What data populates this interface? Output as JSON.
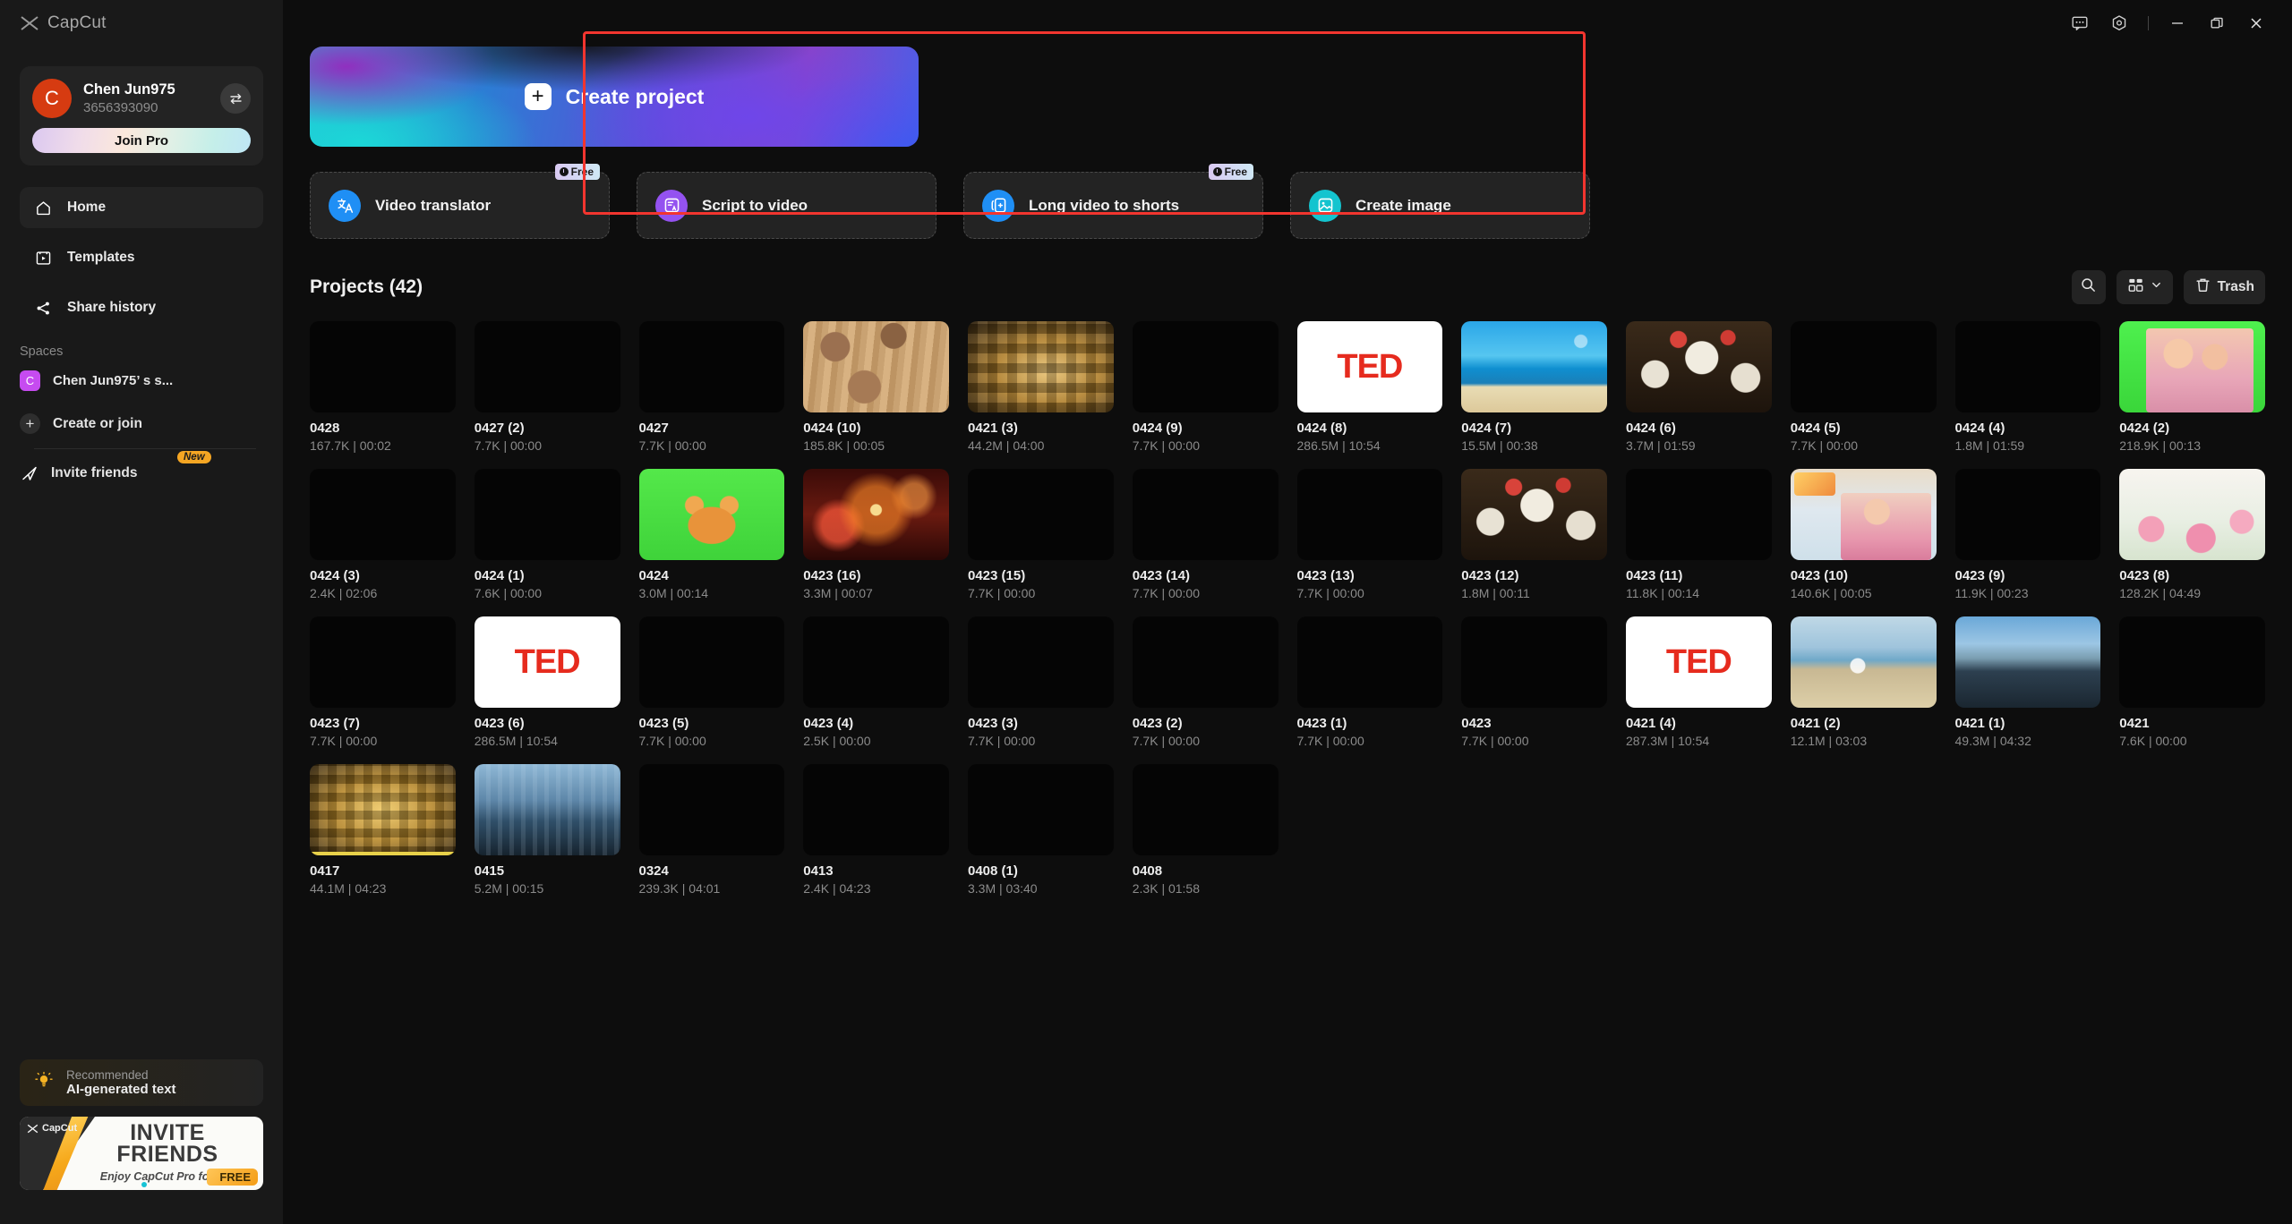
{
  "app": {
    "brand": "CapCut"
  },
  "titlebar": {
    "buttons": [
      {
        "name": "feedback-icon",
        "label": ""
      },
      {
        "name": "settings-icon",
        "label": ""
      },
      {
        "name": "minimize-icon",
        "label": ""
      },
      {
        "name": "maximize-icon",
        "label": ""
      },
      {
        "name": "close-icon",
        "label": ""
      }
    ]
  },
  "sidebar": {
    "user": {
      "name": "Chen Jun975",
      "id": "3656393090",
      "avatar_initial": "C",
      "avatar_color": "#d63b11",
      "switch_icon": "⇄",
      "pro_button": "Join Pro"
    },
    "nav": [
      {
        "label": "Home",
        "icon": "home-icon",
        "active": true
      },
      {
        "label": "Templates",
        "icon": "templates-icon",
        "active": false
      },
      {
        "label": "Share history",
        "icon": "share-icon",
        "active": false
      }
    ],
    "spaces_label": "Spaces",
    "spaces": [
      {
        "label": "Chen Jun975’ s s...",
        "badge": "C",
        "badge_color": "#c64bf0"
      }
    ],
    "create_or_join": "Create or join",
    "invite_friends": "Invite friends",
    "invite_badge": "New",
    "promo": {
      "recommended_label": "Recommended",
      "recommended_title": "AI-generated text",
      "card_brand": "CapCut",
      "card_title_line1": "INVITE",
      "card_title_line2": "FRIENDS",
      "card_subtitle": "Enjoy CapCut Pro for",
      "card_free": "FREE"
    }
  },
  "main": {
    "create_project": {
      "label": "Create project",
      "icon": "plus-icon"
    },
    "features": [
      {
        "label": "Video translator",
        "icon": "translate-icon",
        "icon_color": "#1f8ff5",
        "badge": "Free"
      },
      {
        "label": "Script to video",
        "icon": "script-icon",
        "icon_color": "#9452f0",
        "badge": ""
      },
      {
        "label": "Long video to shorts",
        "icon": "shorts-icon",
        "icon_color": "#1f8ff5",
        "badge": "Free"
      },
      {
        "label": "Create image",
        "icon": "image-icon",
        "icon_color": "#14c4cf",
        "badge": ""
      }
    ],
    "projects_title": "Projects",
    "projects_count": "(42)",
    "toolbar": {
      "search_icon": "search-icon",
      "view_icon": "grid-view-icon",
      "view_caret": "chevron-down-icon",
      "trash_label": "Trash",
      "trash_icon": "trash-icon"
    },
    "projects": [
      {
        "name": "0428",
        "meta": "167.7K | 00:02",
        "thumb": "t-black"
      },
      {
        "name": "0427 (2)",
        "meta": "7.7K | 00:00",
        "thumb": "t-black"
      },
      {
        "name": "0427",
        "meta": "7.7K | 00:00",
        "thumb": "t-black"
      },
      {
        "name": "0424 (10)",
        "meta": "185.8K | 00:05",
        "thumb": "t-wood"
      },
      {
        "name": "0421 (3)",
        "meta": "44.2M | 04:00",
        "thumb": "t-mosaic"
      },
      {
        "name": "0424 (9)",
        "meta": "7.7K | 00:00",
        "thumb": "t-black"
      },
      {
        "name": "0424 (8)",
        "meta": "286.5M | 10:54",
        "thumb": "t-ted"
      },
      {
        "name": "0424 (7)",
        "meta": "15.5M | 00:38",
        "thumb": "t-beach"
      },
      {
        "name": "0424 (6)",
        "meta": "3.7M | 01:59",
        "thumb": "t-globes"
      },
      {
        "name": "0424 (5)",
        "meta": "7.7K | 00:00",
        "thumb": "t-black"
      },
      {
        "name": "0424 (4)",
        "meta": "1.8M | 01:59",
        "thumb": "t-black"
      },
      {
        "name": "0424 (2)",
        "meta": "218.9K | 00:13",
        "thumb": "t-green"
      },
      {
        "name": "0424 (3)",
        "meta": "2.4K | 02:06",
        "thumb": "t-black"
      },
      {
        "name": "0424 (1)",
        "meta": "7.6K | 00:00",
        "thumb": "t-black"
      },
      {
        "name": "0424",
        "meta": "3.0M | 00:14",
        "thumb": "t-cat"
      },
      {
        "name": "0423 (16)",
        "meta": "3.3M | 00:07",
        "thumb": "t-fire"
      },
      {
        "name": "0423 (15)",
        "meta": "7.7K | 00:00",
        "thumb": "t-black"
      },
      {
        "name": "0423 (14)",
        "meta": "7.7K | 00:00",
        "thumb": "t-black"
      },
      {
        "name": "0423 (13)",
        "meta": "7.7K | 00:00",
        "thumb": "t-black"
      },
      {
        "name": "0423 (12)",
        "meta": "1.8M | 00:11",
        "thumb": "t-globes"
      },
      {
        "name": "0423 (11)",
        "meta": "11.8K | 00:14",
        "thumb": "t-black"
      },
      {
        "name": "0423 (10)",
        "meta": "140.6K | 00:05",
        "thumb": "t-happy"
      },
      {
        "name": "0423 (9)",
        "meta": "11.9K | 00:23",
        "thumb": "t-black"
      },
      {
        "name": "0423 (8)",
        "meta": "128.2K | 04:49",
        "thumb": "t-flowers"
      },
      {
        "name": "0423 (7)",
        "meta": "7.7K | 00:00",
        "thumb": "t-black"
      },
      {
        "name": "0423 (6)",
        "meta": "286.5M | 10:54",
        "thumb": "t-ted"
      },
      {
        "name": "0423 (5)",
        "meta": "7.7K | 00:00",
        "thumb": "t-black"
      },
      {
        "name": "0423 (4)",
        "meta": "2.5K | 00:00",
        "thumb": "t-black"
      },
      {
        "name": "0423 (3)",
        "meta": "7.7K | 00:00",
        "thumb": "t-black"
      },
      {
        "name": "0423 (2)",
        "meta": "7.7K | 00:00",
        "thumb": "t-black"
      },
      {
        "name": "0423 (1)",
        "meta": "7.7K | 00:00",
        "thumb": "t-black"
      },
      {
        "name": "0423",
        "meta": "7.7K | 00:00",
        "thumb": "t-black"
      },
      {
        "name": "0421 (4)",
        "meta": "287.3M | 10:54",
        "thumb": "t-ted"
      },
      {
        "name": "0421 (2)",
        "meta": "12.1M | 03:03",
        "thumb": "t-beachwalk"
      },
      {
        "name": "0421 (1)",
        "meta": "49.3M | 04:32",
        "thumb": "t-city"
      },
      {
        "name": "0421",
        "meta": "7.6K | 00:00",
        "thumb": "t-black"
      },
      {
        "name": "0417",
        "meta": "44.1M | 04:23",
        "thumb": "t-gold"
      },
      {
        "name": "0415",
        "meta": "5.2M | 00:15",
        "thumb": "t-citynight"
      },
      {
        "name": "0324",
        "meta": "239.3K | 04:01",
        "thumb": "t-black"
      },
      {
        "name": "0413",
        "meta": "2.4K | 04:23",
        "thumb": "t-black"
      },
      {
        "name": "0408 (1)",
        "meta": "3.3M | 03:40",
        "thumb": "t-black"
      },
      {
        "name": "0408",
        "meta": "2.3K | 01:58",
        "thumb": "t-black"
      }
    ]
  },
  "annotation": {
    "highlight_color": "#f2352f"
  }
}
